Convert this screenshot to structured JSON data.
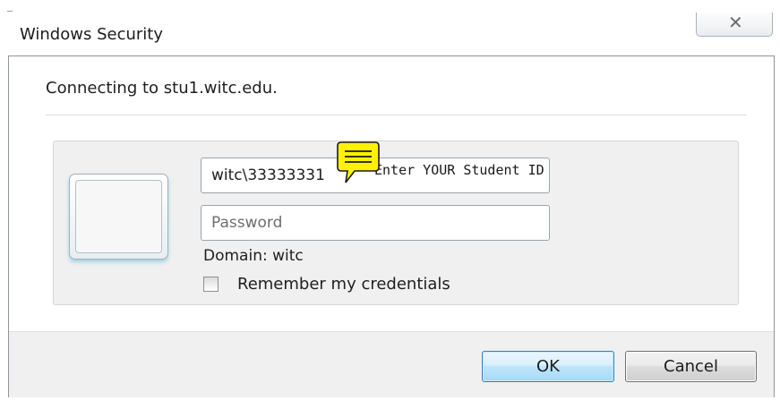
{
  "window": {
    "title": "Windows Security",
    "close_symbol": "✕"
  },
  "dialog": {
    "connecting_text": "Connecting to stu1.witc.edu."
  },
  "credentials": {
    "tile_icon": "user-tile-icon",
    "username_value": "witc\\33333331",
    "password_placeholder": "Password",
    "domain_text": "Domain: witc",
    "remember_label": "Remember my credentials",
    "remember_checked": false
  },
  "annotation": {
    "icon": "sticky-note-icon",
    "text": "Enter YOUR Student ID"
  },
  "buttons": {
    "ok_label": "OK",
    "cancel_label": "Cancel"
  },
  "colors": {
    "ok_border": "#3c7fb1",
    "note_fill": "#fff200",
    "tile_glow": "#50aad2"
  }
}
